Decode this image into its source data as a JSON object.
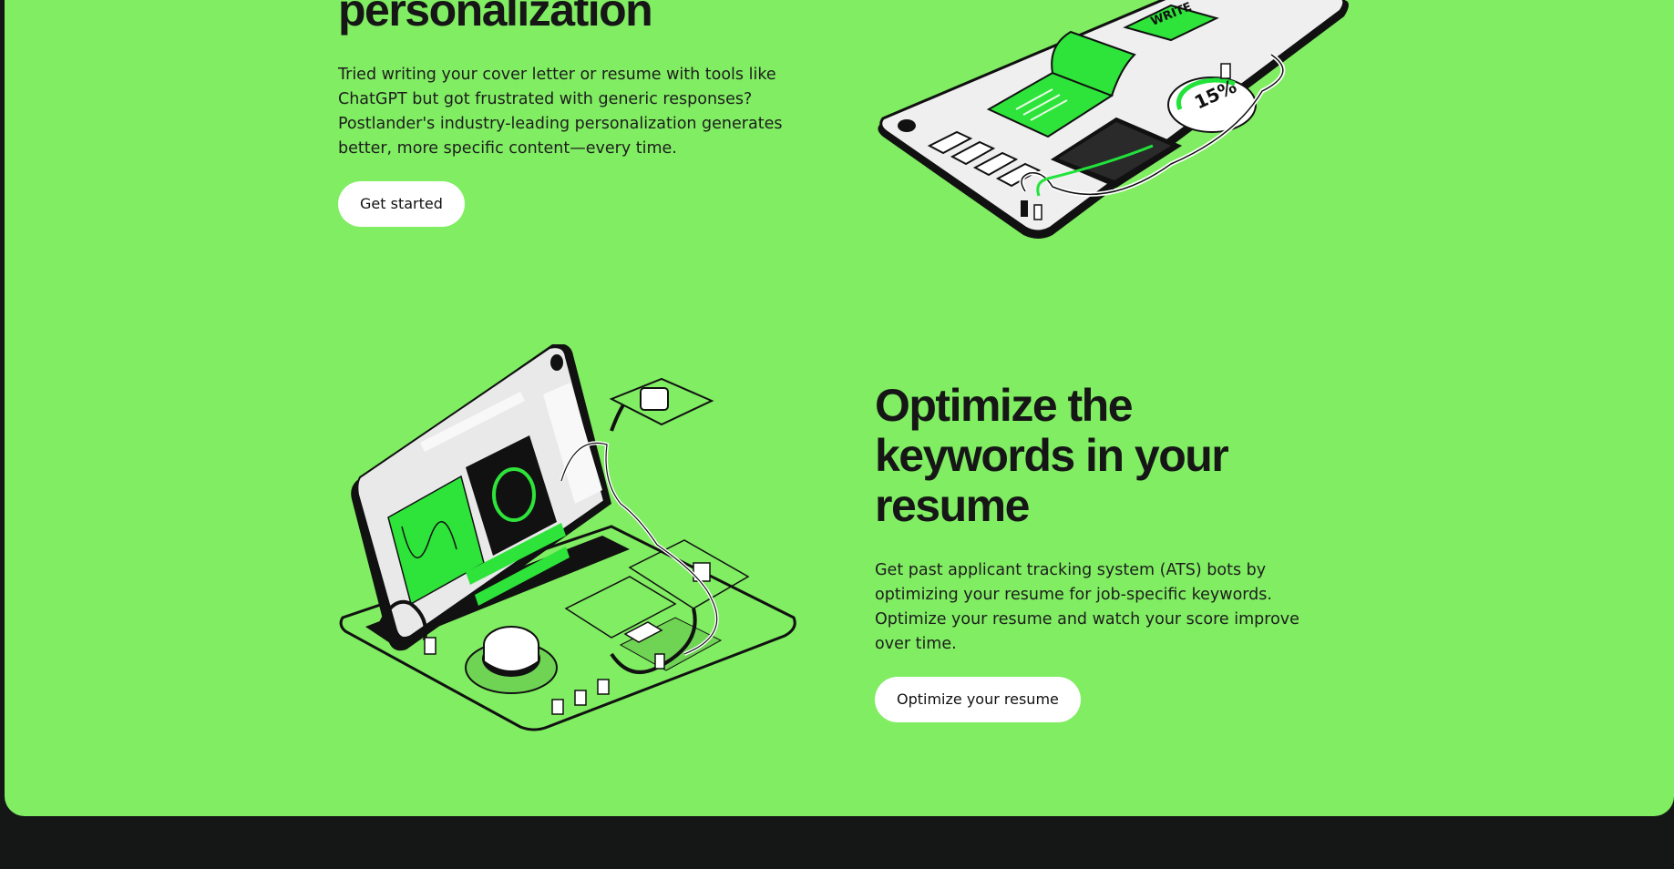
{
  "section_top": {
    "heading_fragment": "personalization",
    "paragraph": "Tried writing your cover letter or resume with tools like ChatGPT but got frustrated with generic responses? Postlander's industry-leading personalization generates better, more specific content—every time.",
    "cta_label": "Get started",
    "illustration": {
      "tag_text": "WRITE",
      "dial_text": "15%"
    }
  },
  "section_bottom": {
    "heading": "Optimize the keywords in your resume",
    "paragraph": "Get past applicant tracking system (ATS) bots by optimizing your resume for job-specific keywords. Optimize your resume and watch your score improve over time.",
    "cta_label": "Optimize your resume"
  },
  "colors": {
    "panel_green": "#80ed62",
    "accent_green": "#22e33a",
    "dark_bg": "#151716",
    "button_bg": "#ffffff"
  }
}
